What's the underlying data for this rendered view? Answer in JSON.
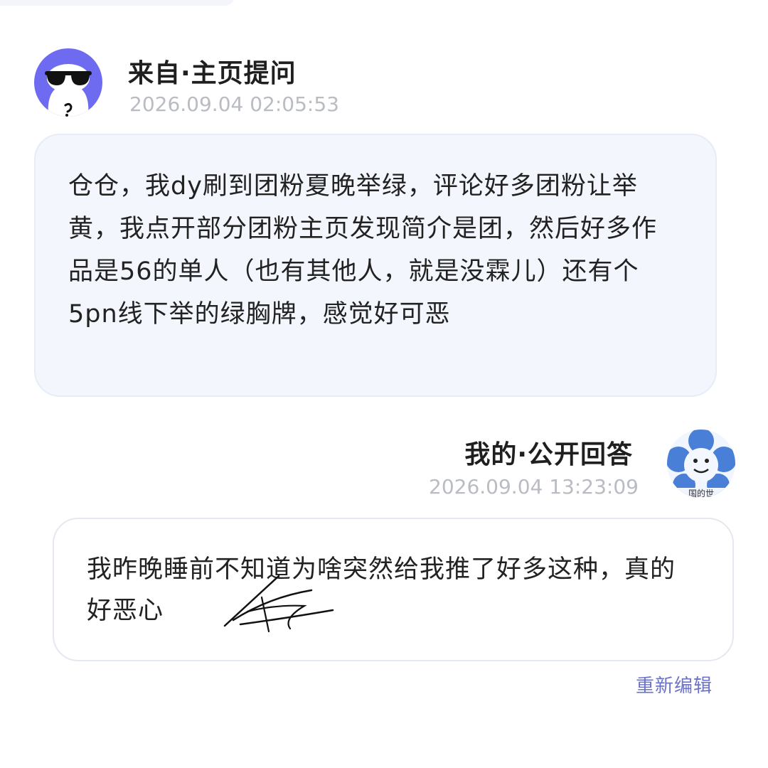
{
  "question": {
    "title": "来自·主页提问",
    "timestamp": "2026.09.04 02:05:53",
    "avatar_icon": "sunglasses-face-icon",
    "text": "仓仓，我dy刷到团粉夏晚举绿，评论好多团粉让举黄，我点开部分团粉主页发现简介是团，然后好多作品是56的单人（也有其他人，就是没霖儿）还有个5pn线下举的绿胸牌，感觉好可恶"
  },
  "answer": {
    "title": "我的·公开回答",
    "timestamp": "2026.09.04 13:23:09",
    "avatar_icon": "blue-flower-face-icon",
    "avatar_caption": "国的世",
    "text": "我昨晚睡前不知道为啥突然给我推了好多这种，真的好恶心"
  },
  "actions": {
    "reedit_label": "重新编辑"
  },
  "colors": {
    "question_avatar_bg": "#6f6bf0",
    "question_bubble_bg": "#f3f7fd",
    "timestamp": "#b9bcc3",
    "link": "#6a73c9"
  }
}
